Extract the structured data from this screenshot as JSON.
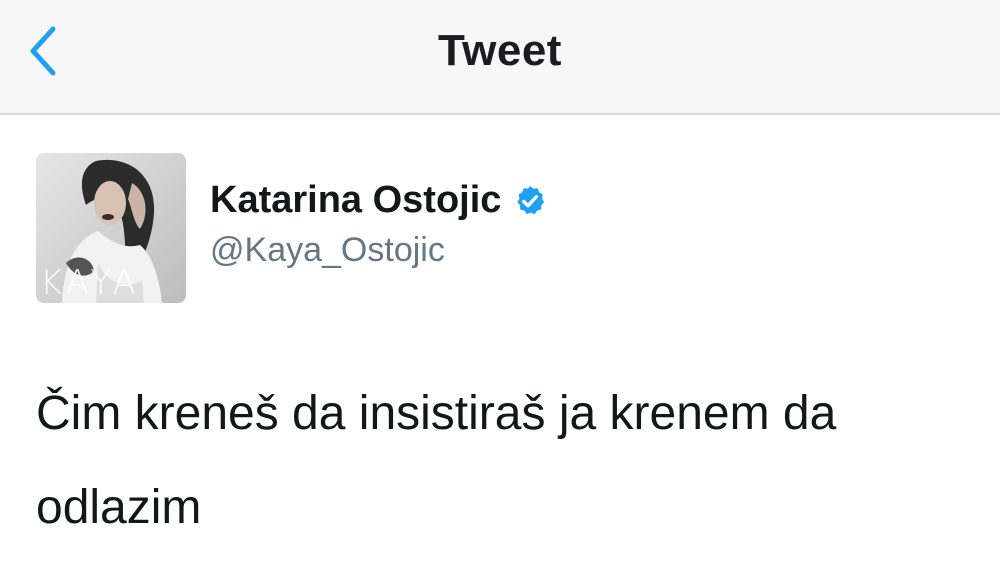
{
  "nav": {
    "title": "Tweet",
    "back_icon": "chevron-left-icon",
    "accent_color": "#1da1f2"
  },
  "tweet": {
    "author": {
      "display_name": "Katarina Ostojic",
      "handle": "@Kaya_Ostojic",
      "verified": true,
      "verified_icon": "verified-badge-icon",
      "avatar_text": "KAYA"
    },
    "text": "Čim kreneš da insistiraš ja krenem da odlazim"
  }
}
